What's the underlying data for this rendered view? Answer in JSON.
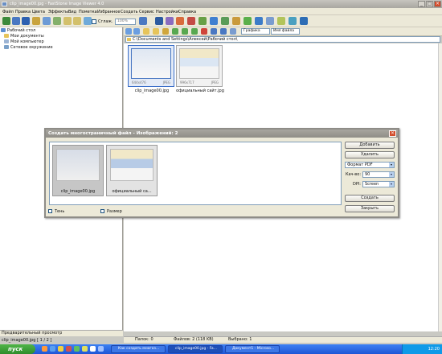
{
  "window": {
    "title": "clip_image00.jpg  -  FastStone Image Viewer 4.0"
  },
  "menu": [
    "Файл",
    "Правка",
    "Цвета",
    "Эффекты",
    "Вид",
    "Пометка",
    "Избранное",
    "Создать",
    "Сервис",
    "Настройки",
    "Справка"
  ],
  "toolbar": {
    "smooth_label": "Сглаж.",
    "zoom_value": "100%",
    "sort_options": [
      "Графика",
      "Имя файла"
    ]
  },
  "tree": {
    "items": [
      {
        "label": "Рабочий стол",
        "indent": 0
      },
      {
        "label": "Мои документы",
        "indent": 1
      },
      {
        "label": "Мой компьютер",
        "indent": 1
      },
      {
        "label": "Сетевое окружение",
        "indent": 1
      }
    ],
    "preview_label": "Предварительный просмотр"
  },
  "address": {
    "path": "C:\\Documents and Settings\\Алексей\\Рабочий стол\\"
  },
  "files": [
    {
      "name": "clip_image00.jpg",
      "dims": "644x476",
      "format": "JPEG"
    },
    {
      "name": "официальный сайт.jpg",
      "dims": "996x717",
      "format": "JPEG"
    }
  ],
  "status": {
    "folders": "Папок: 0",
    "files": "Файлов: 2 (118 KB)",
    "selected": "Выбрано: 1",
    "current": "clip_image00.jpg [ 1 / 2 ]"
  },
  "dialog": {
    "title": "Создать многостраничный файл  -  Изображений: 2",
    "items": [
      {
        "label": "clip_image00.jpg"
      },
      {
        "label": "официальный са..."
      }
    ],
    "buttons": {
      "add": "Добавить",
      "remove": "Удалить",
      "create": "Создать",
      "close": "Закрыть"
    },
    "format": {
      "selected": "Формат PDF"
    },
    "quality": {
      "label": "Кач-во:",
      "value": "90"
    },
    "dpi": {
      "label": "DPI:",
      "value": "Screen"
    },
    "options": {
      "shadow": "Тень",
      "size": "Размер"
    }
  },
  "taskbar": {
    "start": "пуск",
    "tasks": [
      "Как создать многоз...",
      "clip_image00.jpg - Fa...",
      "Документ1 - Microso..."
    ],
    "clock": "12:20"
  },
  "colors": {
    "taskbar": "#245edc",
    "start": "#3c9e37",
    "close": "#d24c2b"
  }
}
